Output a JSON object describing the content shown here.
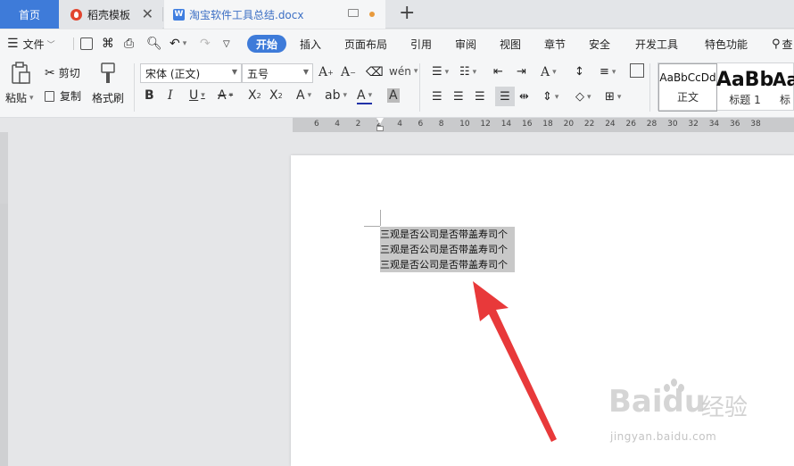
{
  "tabs": {
    "home": "首页",
    "template": "稻壳模板",
    "document": "淘宝软件工具总结.docx"
  },
  "menu": {
    "file": "文件",
    "items": [
      "开始",
      "插入",
      "页面布局",
      "引用",
      "审阅",
      "视图",
      "章节",
      "安全",
      "开发工具",
      "特色功能"
    ],
    "search": "查"
  },
  "ribbon": {
    "paste": "粘贴",
    "cut": "剪切",
    "copy": "复制",
    "format_painter": "格式刷",
    "font_name": "宋体 (正文)",
    "font_size": "五号",
    "styles": [
      {
        "preview": "AaBbCcDd",
        "label": "正文"
      },
      {
        "preview": "AaBb",
        "label": "标题 1"
      },
      {
        "preview": "Aa",
        "label": "标"
      }
    ]
  },
  "ruler": {
    "numbers": [
      "6",
      "4",
      "2",
      "2",
      "4",
      "6",
      "8",
      "10",
      "12",
      "14",
      "16",
      "18",
      "20",
      "22",
      "24",
      "26",
      "28",
      "30",
      "32",
      "34",
      "36",
      "38"
    ]
  },
  "document": {
    "lines": [
      "三观是否公司是否带盖寿司个",
      "三观是否公司是否带盖寿司个",
      "三观是否公司是否带盖寿司个"
    ]
  },
  "watermark": {
    "brand": "Baidu",
    "cn": "经验",
    "url": "jingyan.baidu.com"
  },
  "colors": {
    "accent": "#3e7bd9",
    "arrow": "#e8393a",
    "selection": "#c8c8c8"
  }
}
